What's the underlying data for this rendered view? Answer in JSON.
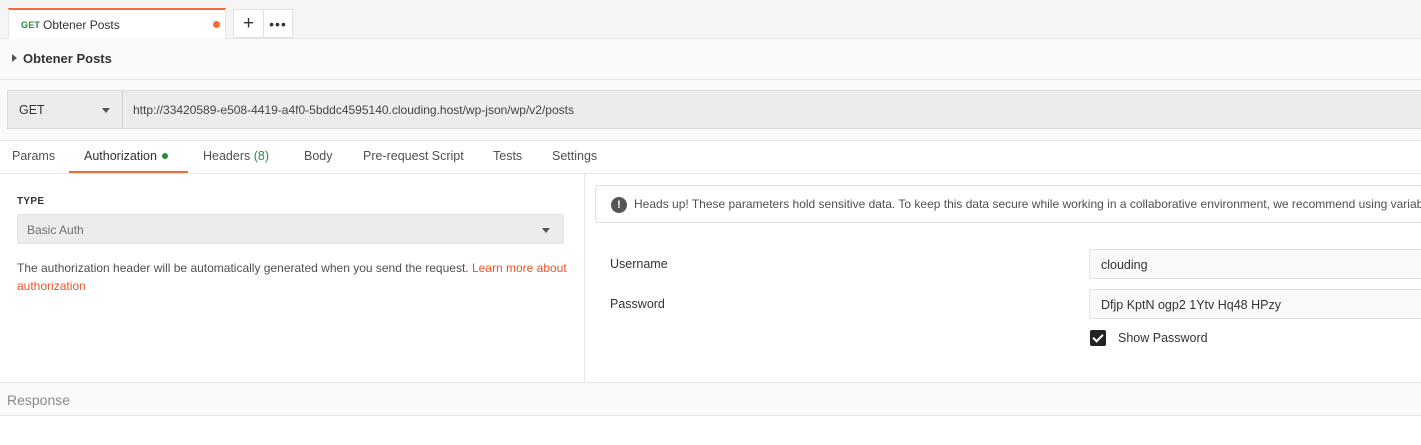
{
  "tab": {
    "method": "GET",
    "name": "Obtener Posts"
  },
  "tab_buttons": {
    "new": "+",
    "more": "•••"
  },
  "request": {
    "title": "Obtener Posts",
    "method": "GET",
    "url": "http://33420589-e508-4419-a4f0-5bddc4595140.clouding.host/wp-json/wp/v2/posts"
  },
  "request_tabs": [
    {
      "label": "Params"
    },
    {
      "label": "Authorization"
    },
    {
      "label": "Headers",
      "count": "(8)"
    },
    {
      "label": "Body"
    },
    {
      "label": "Pre-request Script"
    },
    {
      "label": "Tests"
    },
    {
      "label": "Settings"
    }
  ],
  "auth": {
    "type_label": "TYPE",
    "type_value": "Basic Auth",
    "description": "The authorization header will be automatically generated when you send the request. ",
    "learn_more": "Learn more about authorization",
    "alert": "Heads up! These parameters hold sensitive data. To keep this data secure while working in a collaborative environment, we recommend using variables.",
    "username_label": "Username",
    "username_value": "clouding",
    "password_label": "Password",
    "password_value": "Dfjp KptN ogp2 1Ytv Hq48 HPzy",
    "show_password_label": "Show Password",
    "show_password_checked": true
  },
  "response": {
    "label": "Response"
  },
  "colors": {
    "accent": "#f26b3a",
    "get_method": "#2b8a3e",
    "link": "#e8552a"
  }
}
